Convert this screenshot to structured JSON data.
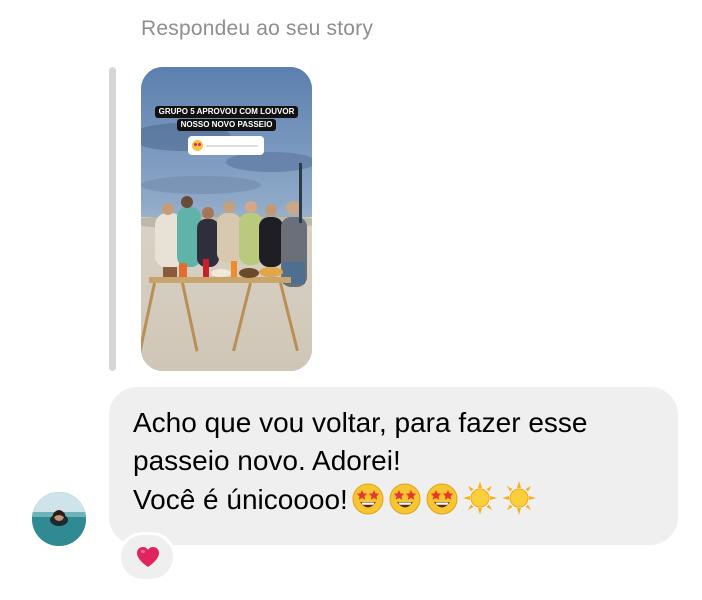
{
  "reply_context": {
    "label": "Respondeu ao seu story"
  },
  "story": {
    "caption_lines": [
      "GRUPO 5 APROVOU COM LOUVOR",
      "NOSSO NOVO PASSEIO"
    ],
    "sticker": "emoji-slider",
    "sticker_emoji": "heart-eyes-emoji"
  },
  "message": {
    "line1": "Acho que vou voltar, para fazer esse",
    "line2": "passeio novo. Adorei!",
    "line3": "Você é únicoooo!",
    "trailing_emojis": [
      "star-struck",
      "star-struck",
      "star-struck",
      "sun",
      "sun"
    ]
  },
  "reaction": {
    "emoji": "red-heart"
  },
  "colors": {
    "bubble": "#efefef",
    "label_gray": "#8e8e93",
    "heart": "#e0245e"
  }
}
